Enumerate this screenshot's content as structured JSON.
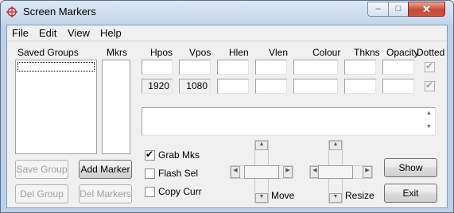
{
  "window": {
    "title": "Screen Markers",
    "caption_minimize": "–",
    "caption_maximize": "□",
    "caption_close": "✕"
  },
  "menu": [
    "File",
    "Edit",
    "View",
    "Help"
  ],
  "headers": {
    "saved_groups": "Saved Groups",
    "mkrs": "Mkrs",
    "hpos": "Hpos",
    "vpos": "Vpos",
    "hlen": "Hlen",
    "vlen": "Vlen",
    "colour": "Colour",
    "thkns": "Thkns",
    "opacity": "Opacity",
    "dotted": "Dotted"
  },
  "row1": {
    "hpos": "",
    "vpos": "",
    "hlen": "",
    "vlen": "",
    "colour": "",
    "thkns": "",
    "opacity": "",
    "dotted_checked": true
  },
  "row2": {
    "hpos": "1920",
    "vpos": "1080",
    "hlen": "",
    "vlen": "",
    "colour": "",
    "thkns": "",
    "opacity": "",
    "dotted_checked": true
  },
  "notes_text": "",
  "buttons": {
    "save_group": "Save Group",
    "add_marker": "Add Marker",
    "del_group": "Del Group",
    "del_markers": "Del Markers",
    "show": "Show",
    "exit": "Exit"
  },
  "options": {
    "grab_mks": {
      "label": "Grab Mks",
      "checked": true
    },
    "flash_sel": {
      "label": "Flash Sel",
      "checked": false
    },
    "copy_curr": {
      "label": "Copy Curr",
      "checked": false
    }
  },
  "pads": {
    "move_label": "Move",
    "resize_label": "Resize"
  },
  "icons": {
    "app": "crosshair-icon",
    "check": "✔",
    "arrow_up": "▲",
    "arrow_down": "▼",
    "arrow_left": "◀",
    "arrow_right": "▶"
  },
  "colors": {
    "accent": "#c74a36",
    "titlebar": "#c6d7ec"
  }
}
